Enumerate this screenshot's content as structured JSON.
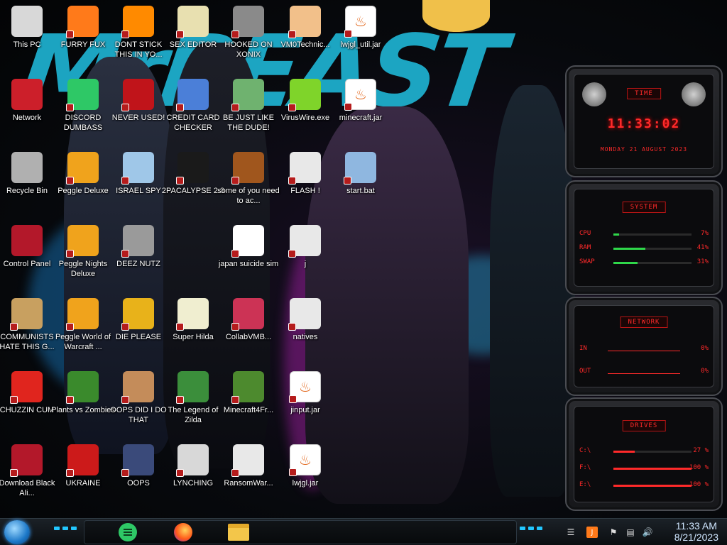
{
  "desktop": {
    "icons": [
      {
        "label": "This PC",
        "icon": "computer-icon",
        "color": "#d8d8d8"
      },
      {
        "label": "FURRY FUX",
        "icon": "firefox-icon",
        "color": "#ff7a1a"
      },
      {
        "label": "DONT STICK THIS IN YO...",
        "icon": "vlc-cone-icon",
        "color": "#ff8a00"
      },
      {
        "label": "SEX EDITOR",
        "icon": "hex-editor-icon",
        "color": "#e8e0b0"
      },
      {
        "label": "HOOKED ON XONIX",
        "icon": "xonix-game-icon",
        "color": "#8a8a8a"
      },
      {
        "label": "VM0Technic...",
        "icon": "doctor-icon",
        "color": "#f2c08a"
      },
      {
        "label": "lwjgl_util.jar",
        "icon": "java-jar-icon",
        "color": "#ffffff"
      },
      {
        "label": "Network",
        "icon": "alienware-network-icon",
        "color": "#cc1f2a"
      },
      {
        "label": "DISCORD DUMBASS",
        "icon": "green-app-icon",
        "color": "#2ec866"
      },
      {
        "label": "NEVER USED!",
        "icon": "dev-cpp-icon",
        "color": "#c0141a"
      },
      {
        "label": "CREDIT CARD CHECKER",
        "icon": "credit-card-icon",
        "color": "#4b7fd8"
      },
      {
        "label": "BE JUST LIKE THE DUDE!",
        "icon": "santa-icon",
        "color": "#6fb26f"
      },
      {
        "label": "VirusWire.exe",
        "icon": "lime-icon",
        "color": "#7fd42a"
      },
      {
        "label": "minecraft.jar",
        "icon": "java-jar-icon",
        "color": "#ffffff"
      },
      {
        "label": "Recycle Bin",
        "icon": "recycle-bin-icon",
        "color": "#b0b0b0"
      },
      {
        "label": "Peggle Deluxe",
        "icon": "peggle-icon",
        "color": "#f0a31c"
      },
      {
        "label": "ISRAEL SPY",
        "icon": "network-share-icon",
        "color": "#9fc7e8"
      },
      {
        "label": "2PACALYPSE 2.3",
        "icon": "terminal-icon",
        "color": "#1a1a1a"
      },
      {
        "label": "some of you need to ac...",
        "icon": "beaver-icon",
        "color": "#a0561d"
      },
      {
        "label": "FLASH !",
        "icon": "file-icon",
        "color": "#e8e8e8"
      },
      {
        "label": "start.bat",
        "icon": "gear-file-icon",
        "color": "#8fb7e0"
      },
      {
        "label": "Control Panel",
        "icon": "control-panel-icon",
        "color": "#b3182a"
      },
      {
        "label": "Peggle Nights Deluxe",
        "icon": "peggle-icon",
        "color": "#f0a31c"
      },
      {
        "label": "DEEZ NUTZ",
        "icon": "stacked-windows-icon",
        "color": "#9a9a9a"
      },
      {
        "label": "japan suicide sim",
        "icon": "installer-icon",
        "color": "#ffffff"
      },
      {
        "label": "j",
        "icon": "file-icon",
        "color": "#e8e8e8"
      },
      {
        "label": "COMMUNISTS HATE THIS G...",
        "icon": "money-bag-icon",
        "color": "#c8a060"
      },
      {
        "label": "Peggle World of Warcraft ...",
        "icon": "peggle-icon",
        "color": "#f0a31c"
      },
      {
        "label": "DIE PLEASE",
        "icon": "de-icon",
        "color": "#e8b21a"
      },
      {
        "label": "Super Hilda",
        "icon": "pixel-art-icon",
        "color": "#f0eed0"
      },
      {
        "label": "CollabVMB...",
        "icon": "monitor-icon",
        "color": "#cc3355"
      },
      {
        "label": "natives",
        "icon": "folder-icon",
        "color": "#e8e8e8"
      },
      {
        "label": "CHUZZIN CUM",
        "icon": "chuzzle-icon",
        "color": "#e0251e"
      },
      {
        "label": "Plants vs Zombies",
        "icon": "plant-icon",
        "color": "#3a8a2c"
      },
      {
        "label": "OOPS DID I DO THAT",
        "icon": "portrait-icon",
        "color": "#c48c5a"
      },
      {
        "label": "The Legend of Zilda",
        "icon": "zelda-icon",
        "color": "#3b8e3b"
      },
      {
        "label": "Minecraft4Fr...",
        "icon": "grass-block-icon",
        "color": "#4d8a2e"
      },
      {
        "label": "jinput.jar",
        "icon": "java-jar-icon",
        "color": "#ffffff"
      },
      {
        "label": "Download Black Ali...",
        "icon": "alienware-icon",
        "color": "#b3182a"
      },
      {
        "label": "UKRAINE",
        "icon": "radiation-icon",
        "color": "#cc1a1a"
      },
      {
        "label": "OOPS",
        "icon": "book-icon",
        "color": "#3a4a7a"
      },
      {
        "label": "LYNCHING",
        "icon": "knot-icon",
        "color": "#d8d8d8"
      },
      {
        "label": "RansomWar...",
        "icon": "skull-icon",
        "color": "#e8e8e8"
      },
      {
        "label": "lwjgl.jar",
        "icon": "java-jar-icon",
        "color": "#ffffff"
      }
    ]
  },
  "widgets": {
    "time": {
      "title": "TIME",
      "clock": "11:33:02",
      "date": "MONDAY 21 AUGUST 2023"
    },
    "system": {
      "title": "SYSTEM",
      "rows": [
        {
          "k": "CPU",
          "v": "7%",
          "pct": 0.07
        },
        {
          "k": "RAM",
          "v": "41%",
          "pct": 0.41
        },
        {
          "k": "SWAP",
          "v": "31%",
          "pct": 0.31
        }
      ]
    },
    "network": {
      "title": "NETWORK",
      "rows": [
        {
          "k": "IN",
          "v": "0%"
        },
        {
          "k": "OUT",
          "v": "0%"
        }
      ]
    },
    "drives": {
      "title": "DRIVES",
      "rows": [
        {
          "k": "C:\\",
          "v": "27 %",
          "pct": 0.27
        },
        {
          "k": "F:\\",
          "v": "100 %",
          "pct": 1.0
        },
        {
          "k": "E:\\",
          "v": "100 %",
          "pct": 1.0
        }
      ]
    }
  },
  "taskbar": {
    "pinned": [
      {
        "name": "green-app",
        "icon": "green-app-icon",
        "color": "#2ec866"
      },
      {
        "name": "firefox",
        "icon": "firefox-icon",
        "color": "#ff7a1a"
      },
      {
        "name": "file-explorer",
        "icon": "folder-icon",
        "color": "#f3c64a"
      }
    ],
    "clock_time": "11:33 AM",
    "clock_date": "8/21/2023"
  },
  "colors": {
    "accent_red": "#ff2a2a",
    "accent_cyan": "#22c7ff"
  }
}
